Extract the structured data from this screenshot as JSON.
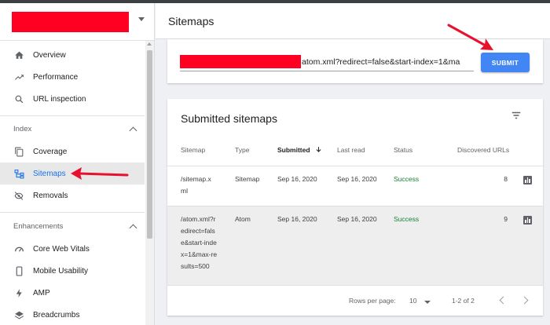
{
  "property": {
    "redacted": true,
    "color": "#ff0022"
  },
  "header": {
    "title": "Sitemaps"
  },
  "sidebar": {
    "items_top": [
      {
        "label": "Overview",
        "icon": "home-icon"
      },
      {
        "label": "Performance",
        "icon": "trending-up-icon"
      },
      {
        "label": "URL inspection",
        "icon": "search-icon"
      }
    ],
    "index_header": "Index",
    "index_items": [
      {
        "label": "Coverage",
        "icon": "copy-icon"
      },
      {
        "label": "Sitemaps",
        "icon": "sitemap-icon",
        "active": true
      },
      {
        "label": "Removals",
        "icon": "eye-off-icon"
      }
    ],
    "enhancements_header": "Enhancements",
    "enhancement_items": [
      {
        "label": "Core Web Vitals",
        "icon": "gauge-icon"
      },
      {
        "label": "Mobile Usability",
        "icon": "phone-icon"
      },
      {
        "label": "AMP",
        "icon": "bolt-icon"
      },
      {
        "label": "Breadcrumbs",
        "icon": "layers-icon"
      }
    ]
  },
  "add_sitemap": {
    "input_value": "atom.xml?redirect=false&start-index=1&ma",
    "submit_label": "SUBMIT"
  },
  "submitted": {
    "title": "Submitted sitemaps",
    "columns": [
      "Sitemap",
      "Type",
      "Submitted",
      "Last read",
      "Status",
      "Discovered URLs"
    ],
    "rows": [
      {
        "sitemap_lines": [
          "/sitemap.x",
          "ml"
        ],
        "type": "Sitemap",
        "submitted": "Sep 16, 2020",
        "last_read": "Sep 16, 2020",
        "status": "Success",
        "discovered": "8"
      },
      {
        "sitemap_lines": [
          "/atom.xml?r",
          "edirect=fals",
          "e&start-inde",
          "x=1&max-re",
          "sults=500"
        ],
        "type": "Atom",
        "submitted": "Sep 16, 2020",
        "last_read": "Sep 16, 2020",
        "status": "Success",
        "discovered": "9"
      }
    ],
    "footer": {
      "rows_per_page_label": "Rows per page:",
      "rows_per_page": "10",
      "range": "1-2 of 2"
    }
  },
  "colors": {
    "accent": "#4285f4",
    "success": "#188038",
    "annotation_arrow": "#e8112d"
  }
}
